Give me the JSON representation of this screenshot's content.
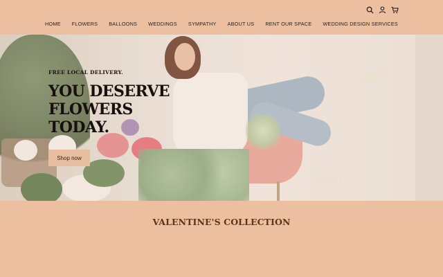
{
  "header": {
    "icons": [
      "search-icon",
      "account-icon",
      "cart-icon"
    ]
  },
  "nav": {
    "items": [
      {
        "label": "HOME"
      },
      {
        "label": "FLOWERS"
      },
      {
        "label": "BALLOONS"
      },
      {
        "label": "WEDDINGS"
      },
      {
        "label": "SYMPATHY"
      },
      {
        "label": "ABOUT US"
      },
      {
        "label": "RENT OUR SPACE"
      },
      {
        "label": "WEDDING DESIGN SERVICES"
      }
    ]
  },
  "hero": {
    "kicker": "FREE LOCAL DELIVERY.",
    "headline_line1": "YOU DESERVE",
    "headline_line2": "FLOWERS",
    "headline_line3": "TODAY.",
    "cta_label": "Shop now"
  },
  "collection": {
    "title": "VALENTINE'S COLLECTION"
  },
  "colors": {
    "background": "#ecbfa1",
    "title": "#5c3416",
    "text": "#2b1d16"
  }
}
